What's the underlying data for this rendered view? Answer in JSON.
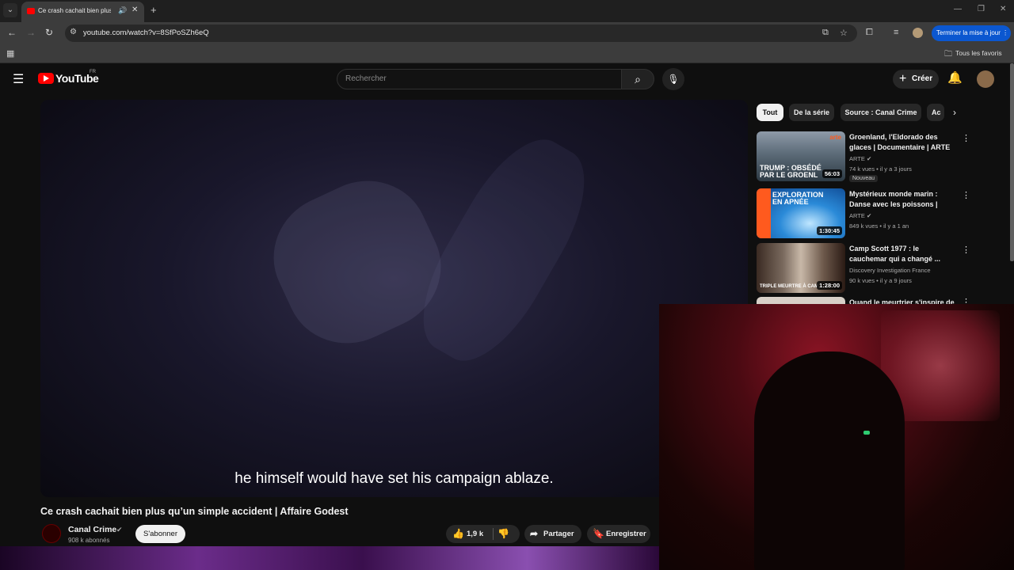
{
  "browser": {
    "tab_title": "Ce crash cachait bien plus qu'un simple accident",
    "url": "youtube.com/watch?v=8SfPoSZh6eQ",
    "update_button": "Terminer la mise à jour",
    "bookmarks_label": "Tous les favoris",
    "icons": {
      "tab_list": "chevron-down-icon",
      "audio": "speaker-icon",
      "close": "close-icon",
      "new_tab": "plus-icon",
      "back": "arrow-left-icon",
      "forward": "arrow-right-icon",
      "reload": "reload-icon",
      "bookmark": "star-icon"
    }
  },
  "youtube": {
    "logo_text": "YouTube",
    "country_code": "FR",
    "search_placeholder": "Rechercher",
    "create_label": "Créer",
    "accent_color": "#ff0000"
  },
  "video": {
    "subtitle": "he himself would have set his campaign ablaze.",
    "title": "Ce crash cachait bien plus qu’un simple accident | Affaire Godest",
    "channel_name": "Canal Crime",
    "subscribers": "908 k abonnés",
    "subscribe_label": "S'abonner",
    "likes": "1,9 k",
    "share_label": "Partager",
    "save_label": "Enregistrer"
  },
  "sidebar": {
    "chips": [
      "Tout",
      "De la série",
      "Source : Canal Crime",
      "Ac"
    ],
    "recommendations": [
      {
        "title": "Groenland, l'Eldorado des glaces | Documentaire | ARTE",
        "channel": "ARTE",
        "meta": "74 k vues • il y a 3 jours",
        "badge": "Nouveau",
        "duration": "56:03",
        "thumb_overlay": "TRUMP : OBSÉDÉ PAR LE GROENL",
        "thumb_brand": "arte"
      },
      {
        "title": "Mystérieux monde marin : Danse avec les poissons | ARTE",
        "channel": "ARTE",
        "meta": "849 k vues • il y a 1 an",
        "duration": "1:30:45",
        "thumb_overlay": "EXPLORATION EN APNÉE",
        "thumb_brand": "arte"
      },
      {
        "title": "Camp Scott 1977 : le cauchemar qui a changé ...",
        "channel": "Discovery Investigation France",
        "meta": "90 k vues • il y a 9 jours",
        "duration": "1:28:00",
        "thumb_overlay": "TRIPLE MEURTRE À CAM"
      },
      {
        "title": "Quand le meurtrier s'inspire de"
      }
    ]
  }
}
